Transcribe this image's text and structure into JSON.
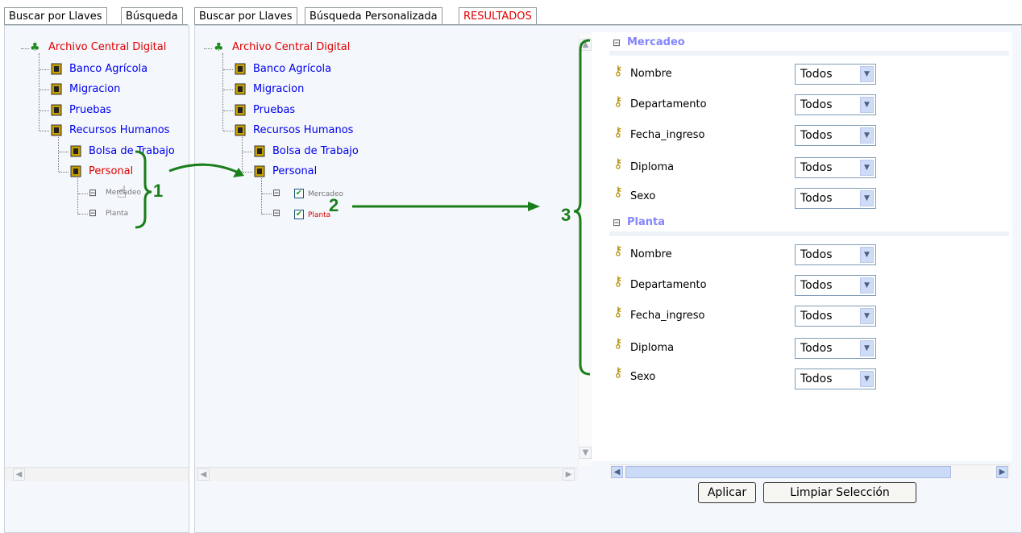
{
  "left_tabs": [
    "Buscar por Llaves",
    "Búsqueda"
  ],
  "middle_tabs": [
    "Buscar por Llaves",
    "Búsqueda Personalizada",
    "RESULTADOS"
  ],
  "tree": {
    "root": "Archivo Central Digital",
    "items": [
      "Banco Agrícola",
      "Migracion",
      "Pruebas",
      "Recursos Humanos"
    ],
    "children": [
      "Bolsa de Trabajo",
      "Personal"
    ],
    "grandchildren": [
      "Mercadeo",
      "Planta"
    ]
  },
  "sections": [
    {
      "title": "Mercadeo",
      "fields": [
        {
          "label": "Nombre",
          "value": "Todos"
        },
        {
          "label": "Departamento",
          "value": "Todos"
        },
        {
          "label": "Fecha_ingreso",
          "value": "Todos"
        },
        {
          "label": "Diploma",
          "value": "Todos"
        },
        {
          "label": "Sexo",
          "value": "Todos"
        }
      ]
    },
    {
      "title": "Planta",
      "fields": [
        {
          "label": "Nombre",
          "value": "Todos"
        },
        {
          "label": "Departamento",
          "value": "Todos"
        },
        {
          "label": "Fecha_ingreso",
          "value": "Todos"
        },
        {
          "label": "Diploma",
          "value": "Todos"
        },
        {
          "label": "Sexo",
          "value": "Todos"
        }
      ]
    }
  ],
  "buttons": {
    "apply": "Aplicar",
    "clear": "Limpiar Selección"
  },
  "annotations": [
    "1",
    "2",
    "3"
  ],
  "colors": {
    "annotation": "#1a7f1a",
    "selected": "#e00000",
    "link": "#0000ee"
  }
}
